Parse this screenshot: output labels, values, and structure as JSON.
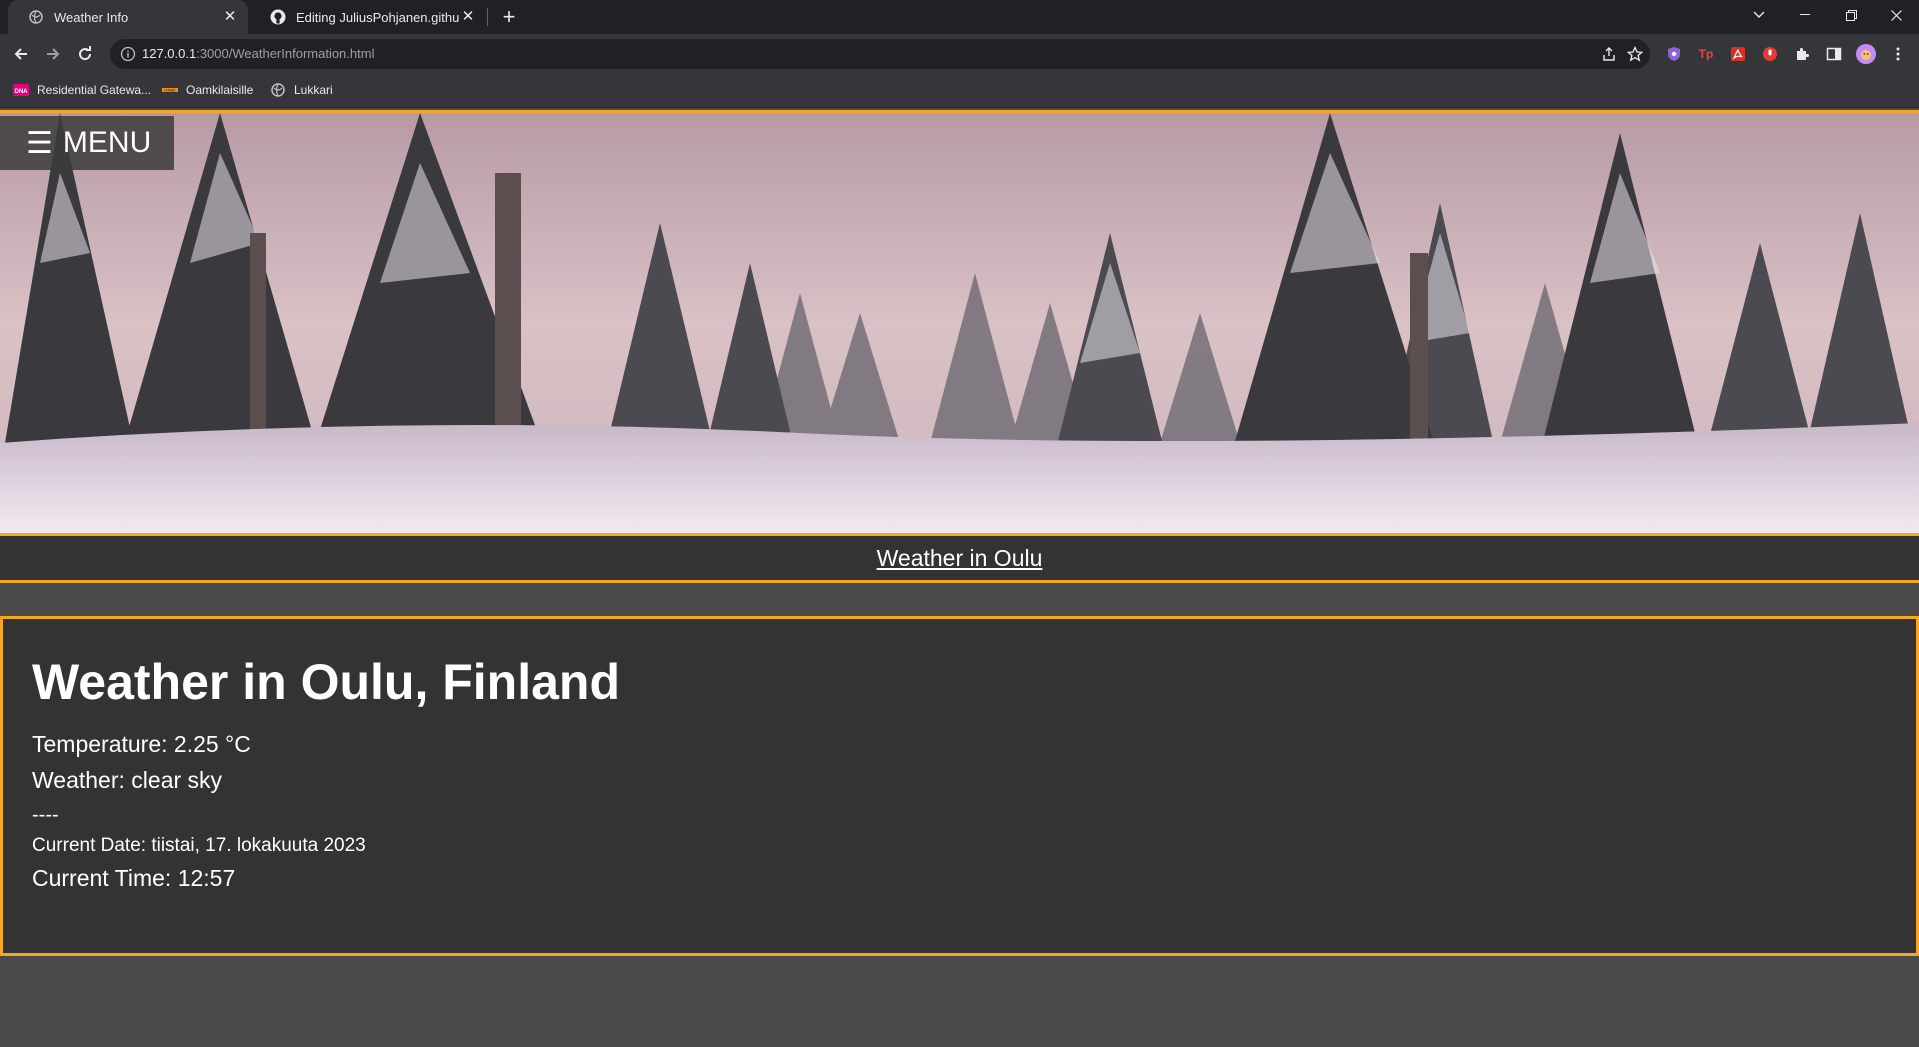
{
  "browser": {
    "tabs": [
      {
        "title": "Weather Info",
        "active": true
      },
      {
        "title": "Editing JuliusPohjanen.github.io/",
        "active": false
      }
    ],
    "address": {
      "host": "127.0.0.1",
      "rest": ":3000/WeatherInformation.html"
    },
    "bookmarks": [
      {
        "label": "Residential Gatewa...",
        "icon": "dna-icon"
      },
      {
        "label": "Oamkilaisille",
        "icon": "oamk-icon"
      },
      {
        "label": "Lukkari",
        "icon": "globe-icon"
      }
    ],
    "extension_labels": {
      "tp": "Tp"
    }
  },
  "page": {
    "menu_label": "MENU",
    "hero_image": "snowy forest at dusk",
    "subnav_link": "Weather in Oulu",
    "heading": "Weather in Oulu, Finland",
    "temperature": "Temperature: 2.25 °C",
    "weather": "Weather: clear sky",
    "separator": "----",
    "date": "Current Date: tiistai, 17. lokakuuta 2023",
    "time": "Current Time: 12:57"
  },
  "colors": {
    "accent": "#f5a623",
    "page_bg": "#4a4a4a",
    "panel_bg": "#333333"
  }
}
